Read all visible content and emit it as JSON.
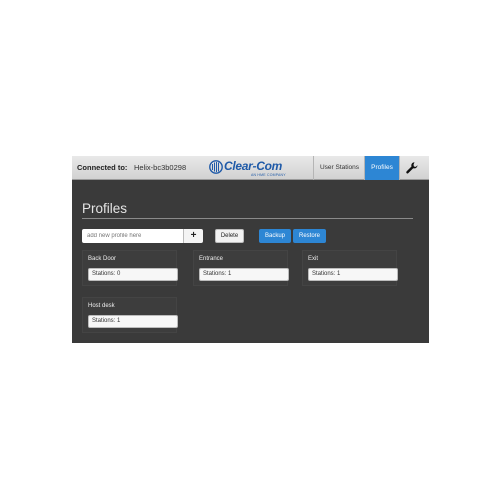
{
  "header": {
    "connected_label": "Connected to:",
    "connected_value": "Helix-bc3b0298",
    "logo_text": "Clear-Com",
    "logo_sub": "AN HME COMPANY",
    "nav": [
      {
        "label": "User Stations",
        "active": false
      },
      {
        "label": "Profiles",
        "active": true
      }
    ],
    "settings_icon": "wrench-icon"
  },
  "page": {
    "title": "Profiles",
    "new_profile_placeholder": "add new profile here",
    "add_icon": "plus-icon",
    "delete_label": "Delete",
    "backup_label": "Backup",
    "restore_label": "Restore"
  },
  "profiles": [
    {
      "name": "Back Door",
      "stations": "Stations: 0"
    },
    {
      "name": "Entrance",
      "stations": "Stations: 1"
    },
    {
      "name": "Exit",
      "stations": "Stations: 1"
    },
    {
      "name": "Host desk",
      "stations": "Stations: 1"
    }
  ],
  "colors": {
    "accent": "#2d86d4",
    "brand": "#1f5aa8",
    "panel": "#3a3a3a"
  }
}
